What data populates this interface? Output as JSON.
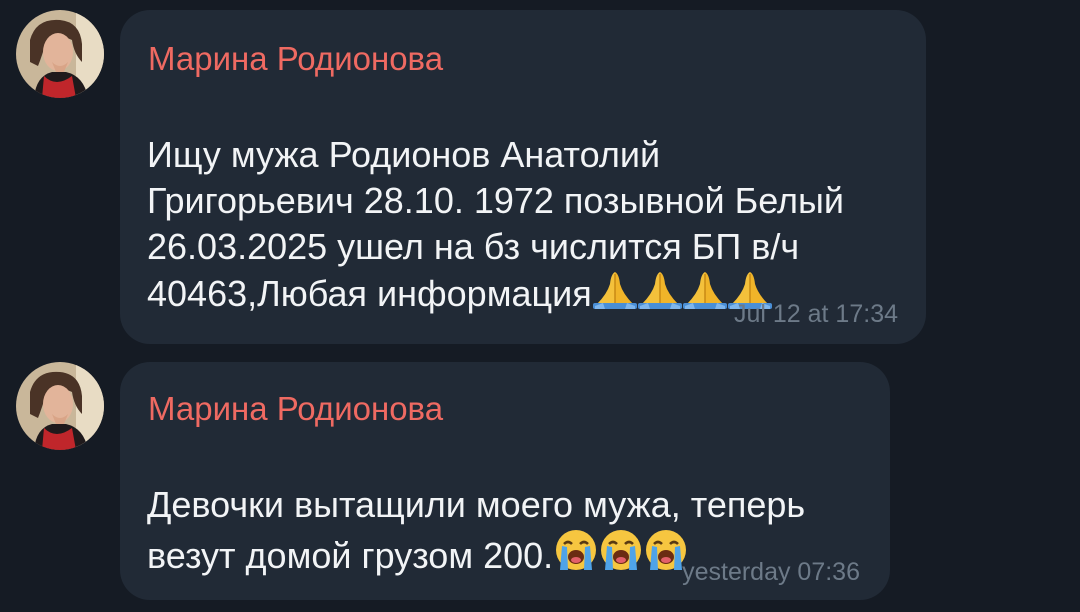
{
  "messages": [
    {
      "sender": "Марина Родионова",
      "text": "Ищу мужа Родионов Анатолий\nГригорьевич 28.10. 1972 позывной Белый\n26.03.2025 ушел на бз числится БП в/ч\n40463,Любая информация",
      "emoji": [
        "folded-hands",
        "folded-hands",
        "folded-hands",
        "folded-hands"
      ],
      "time": "Jul 12 at 17:34"
    },
    {
      "sender": "Марина Родионова",
      "text": "Девочки вытащили моего мужа, теперь\nвезут домой грузом 200.",
      "emoji": [
        "loudly-crying-face",
        "loudly-crying-face",
        "loudly-crying-face"
      ],
      "time": "yesterday 07:36"
    }
  ],
  "colors": {
    "background": "#151b24",
    "bubble": "#212a36",
    "sender_name": "#ef6a62",
    "message_text": "#f2f4f6",
    "timestamp": "#6d7a88"
  }
}
